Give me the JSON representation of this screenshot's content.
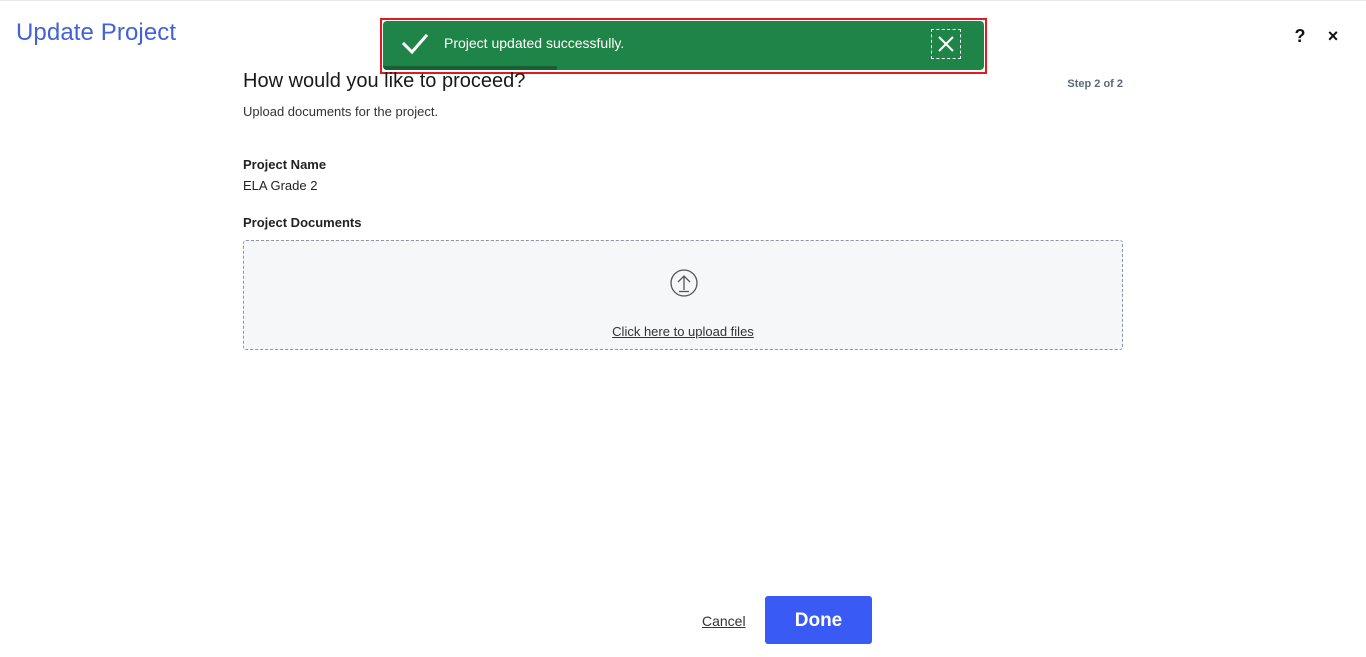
{
  "header": {
    "title": "Update Project",
    "help_label": "?",
    "close_label": "×"
  },
  "toast": {
    "message": "Project updated successfully.",
    "status": "success",
    "color": "#1f8447",
    "icon": "check-icon",
    "close_icon": "close-icon",
    "progress_fraction": 0.29
  },
  "step": {
    "title": "How would you like to proceed?",
    "indicator": "Step 2 of 2",
    "subtitle": "Upload documents for the project."
  },
  "form": {
    "project_name_label": "Project Name",
    "project_name_value": "ELA Grade 2",
    "documents_label": "Project Documents",
    "upload_icon": "upload-icon",
    "upload_link": "Click here to upload files"
  },
  "footer": {
    "cancel_label": "Cancel",
    "done_label": "Done",
    "accent": "#3a5af6"
  }
}
